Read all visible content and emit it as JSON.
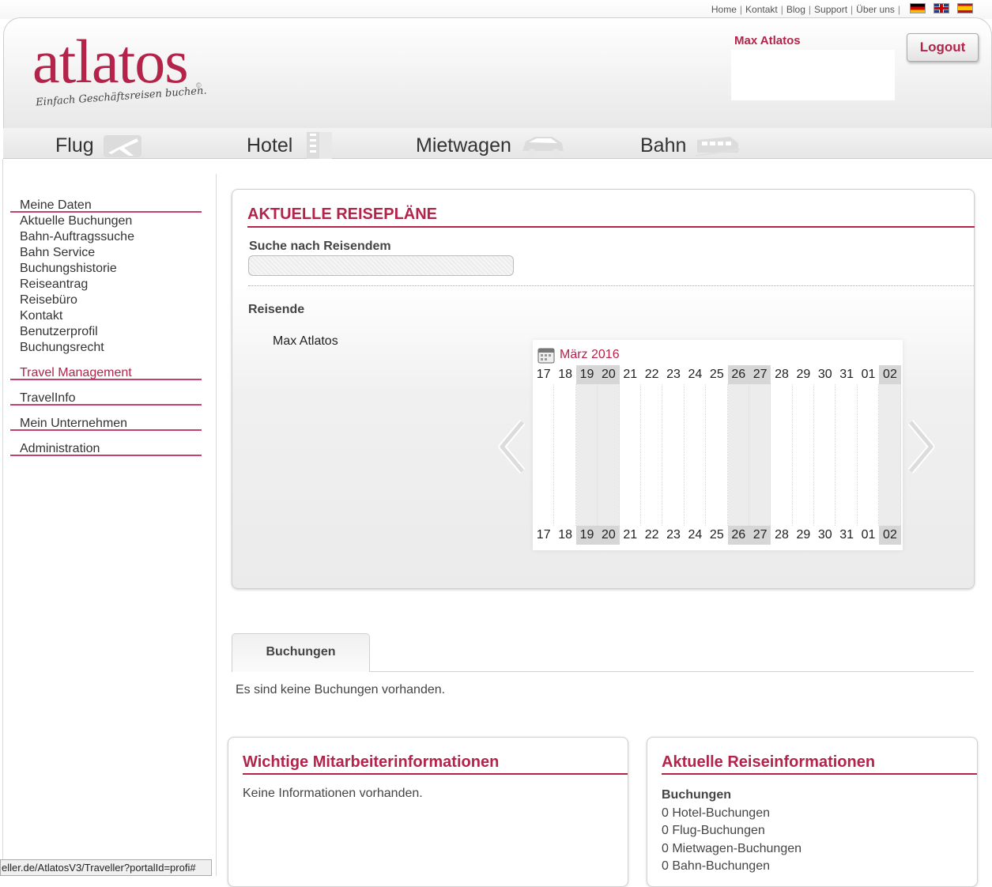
{
  "toplinks": [
    "Home",
    "Kontakt",
    "Blog",
    "Support",
    "Über uns"
  ],
  "header": {
    "logo": "atlatos",
    "logo_mark": "©",
    "tagline": "Einfach Geschäftsreisen buchen.",
    "user_name": "Max Atlatos",
    "logout_label": "Logout"
  },
  "nav": [
    {
      "label": "Flug",
      "icon": "plane-icon"
    },
    {
      "label": "Hotel",
      "icon": "building-icon"
    },
    {
      "label": "Mietwagen",
      "icon": "car-icon"
    },
    {
      "label": "Bahn",
      "icon": "train-icon"
    }
  ],
  "sidemenu": {
    "group1_head": "Meine Daten",
    "group1_items": [
      "Aktuelle Buchungen",
      "Bahn-Auftragssuche",
      "Bahn Service",
      "Buchungshistorie",
      "Reiseantrag",
      "Reisebüro",
      "Kontakt",
      "Benutzerprofil",
      "Buchungsrecht"
    ],
    "travel_management": "Travel Management",
    "travelinfo": "TravelInfo",
    "mein_unternehmen": "Mein Unternehmen",
    "administration": "Administration"
  },
  "reiseplaene": {
    "title": "AKTUELLE REISEPLÄNE",
    "search_label": "Suche nach Reisendem",
    "search_value": "",
    "reisende_label": "Reisende",
    "travellers": [
      "Max Atlatos"
    ],
    "calendar": {
      "month": "März 2016",
      "days": [
        "17",
        "18",
        "19",
        "20",
        "21",
        "22",
        "23",
        "24",
        "25",
        "26",
        "27",
        "28",
        "29",
        "30",
        "31",
        "01",
        "02"
      ],
      "weekend_days": [
        "19",
        "20",
        "26",
        "27",
        "02"
      ]
    }
  },
  "tabs": {
    "bookings_label": "Buchungen",
    "empty_text": "Es sind keine Buchungen vorhanden."
  },
  "mitarbeiterinfo": {
    "title": "Wichtige Mitarbeiterinformationen",
    "text": "Keine Informationen vorhanden."
  },
  "reiseinfo": {
    "title": "Aktuelle Reiseinformationen",
    "heading": "Buchungen",
    "items": [
      "0 Hotel-Buchungen",
      "0 Flug-Buchungen",
      "0 Mietwagen-Buchungen",
      "0 Bahn-Buchungen"
    ]
  },
  "statusbar": "eller.de/AtlatosV3/Traveller?portalId=profi#",
  "colors": {
    "accent": "#b3234a"
  }
}
